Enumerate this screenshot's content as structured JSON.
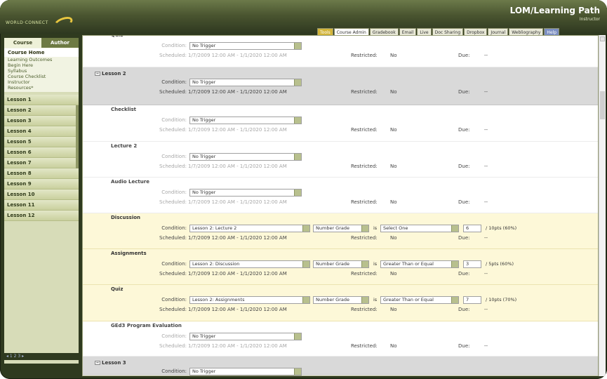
{
  "header": {
    "logo_text": "WORLD·CONNECT",
    "course_title": "LOM/Learning Path",
    "role": "Instructor"
  },
  "tabs": [
    "Tools",
    "Course Admin",
    "Gradebook",
    "Email",
    "Live",
    "Doc Sharing",
    "Dropbox",
    "Journal",
    "Webliography",
    "Help"
  ],
  "nav": {
    "course_label": "Course",
    "author_label": "Author",
    "home": "Course Home",
    "links": [
      "Learning Outcomes",
      "Begin Here",
      "Syllabus",
      "Course Checklist",
      "Instructor",
      "Resources*"
    ],
    "lessons": [
      "Lesson 1",
      "Lesson 2",
      "Lesson 3",
      "Lesson 4",
      "Lesson 5",
      "Lesson 6",
      "Lesson 7",
      "Lesson 8",
      "Lesson 9",
      "Lesson 10",
      "Lesson 11",
      "Lesson 12"
    ],
    "footer": "◂ 1 2 3 ▸"
  },
  "labels": {
    "condition": "Condition:",
    "scheduled": "Scheduled:",
    "restricted": "Restricted:",
    "due": "Due:",
    "no": "No",
    "dash": "--",
    "is": "is",
    "schedule_range": "1/7/2009 12:00 AM - 1/1/2020 12:00 AM"
  },
  "rows": [
    {
      "name": "Quiz",
      "type": "item",
      "style": "white faded",
      "condition": "No Trigger"
    },
    {
      "name": "Lesson 2",
      "type": "lesson",
      "style": "grey",
      "condition": "No Trigger"
    },
    {
      "name": "Checklist",
      "type": "item",
      "style": "white faded",
      "condition": "No Trigger"
    },
    {
      "name": "Lecture 2",
      "type": "item",
      "style": "white faded",
      "condition": "No Trigger"
    },
    {
      "name": "Audio Lecture",
      "type": "item",
      "style": "white faded",
      "condition": "No Trigger"
    },
    {
      "name": "Discussion",
      "type": "item",
      "style": "yellow",
      "condition": "Lesson 2: Lecture 2",
      "grade": "Number Grade",
      "operator": "Select One",
      "score": "6",
      "points": "/ 10pts   (60%)"
    },
    {
      "name": "Assignments",
      "type": "item",
      "style": "yellow",
      "condition": "Lesson 2: Discussion",
      "grade": "Number Grade",
      "operator": "Greater Than or Equal",
      "score": "3",
      "points": "/ 5pts  (60%)"
    },
    {
      "name": "Quiz",
      "type": "item",
      "style": "yellow",
      "condition": "Lesson 2: Assignments",
      "grade": "Number Grade",
      "operator": "Greater Than or Equal",
      "score": "7",
      "points": "/ 10pts  (70%)"
    },
    {
      "name": "GEd3 Program Evaluation",
      "type": "item",
      "style": "white faded",
      "condition": "No Trigger"
    },
    {
      "name": "Lesson 3",
      "type": "lesson",
      "style": "grey",
      "condition": "No Trigger"
    }
  ]
}
